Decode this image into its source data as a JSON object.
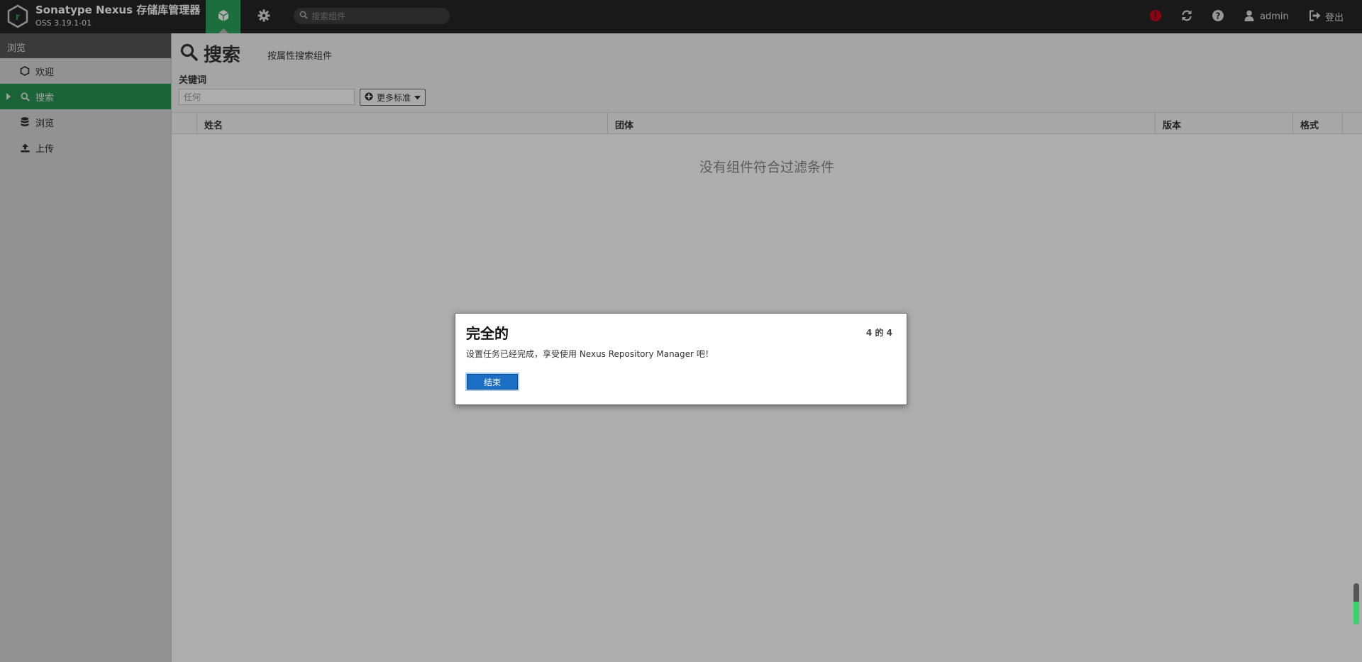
{
  "header": {
    "app_title": "Sonatype Nexus 存储库管理器",
    "app_version": "OSS 3.19.1-01",
    "search_placeholder": "搜索组件",
    "user_label": "admin",
    "signout_label": "登出",
    "icons": {
      "logo": "nexus-logo-icon",
      "browse_mode": "cube-icon",
      "admin_mode": "gear-icon",
      "search": "search-icon",
      "alert": "alert-circle-icon",
      "refresh": "refresh-icon",
      "help": "question-circle-icon",
      "user": "user-icon",
      "signout": "sign-out-icon"
    },
    "colors": {
      "bg": "#262626",
      "active_mode": "#2ba25a",
      "alert": "#d0021b"
    }
  },
  "sidebar": {
    "heading": "浏览",
    "items": [
      {
        "label": "欢迎",
        "icon": "hexagon-icon",
        "active": false
      },
      {
        "label": "搜索",
        "icon": "search-icon",
        "active": true
      },
      {
        "label": "浏览",
        "icon": "database-icon",
        "active": false
      },
      {
        "label": "上传",
        "icon": "upload-icon",
        "active": false
      }
    ],
    "colors": {
      "active": "#2ba25a"
    }
  },
  "main": {
    "title": "搜索",
    "subtitle": "按属性搜索组件",
    "keyword_label": "关键词",
    "keyword_placeholder": "任何",
    "more_criteria_label": "更多标准",
    "columns": [
      "姓名",
      "团体",
      "版本",
      "格式"
    ],
    "empty_message": "没有组件符合过滤条件"
  },
  "dialog": {
    "title": "完全的",
    "step": "4 的 4",
    "message": "设置任务已经完成，享受使用 Nexus Repository Manager 吧！",
    "finish_label": "结束",
    "colors": {
      "button": "#1a6fc4"
    }
  },
  "scroll_indicator": {
    "fill_fraction": 0.55
  }
}
